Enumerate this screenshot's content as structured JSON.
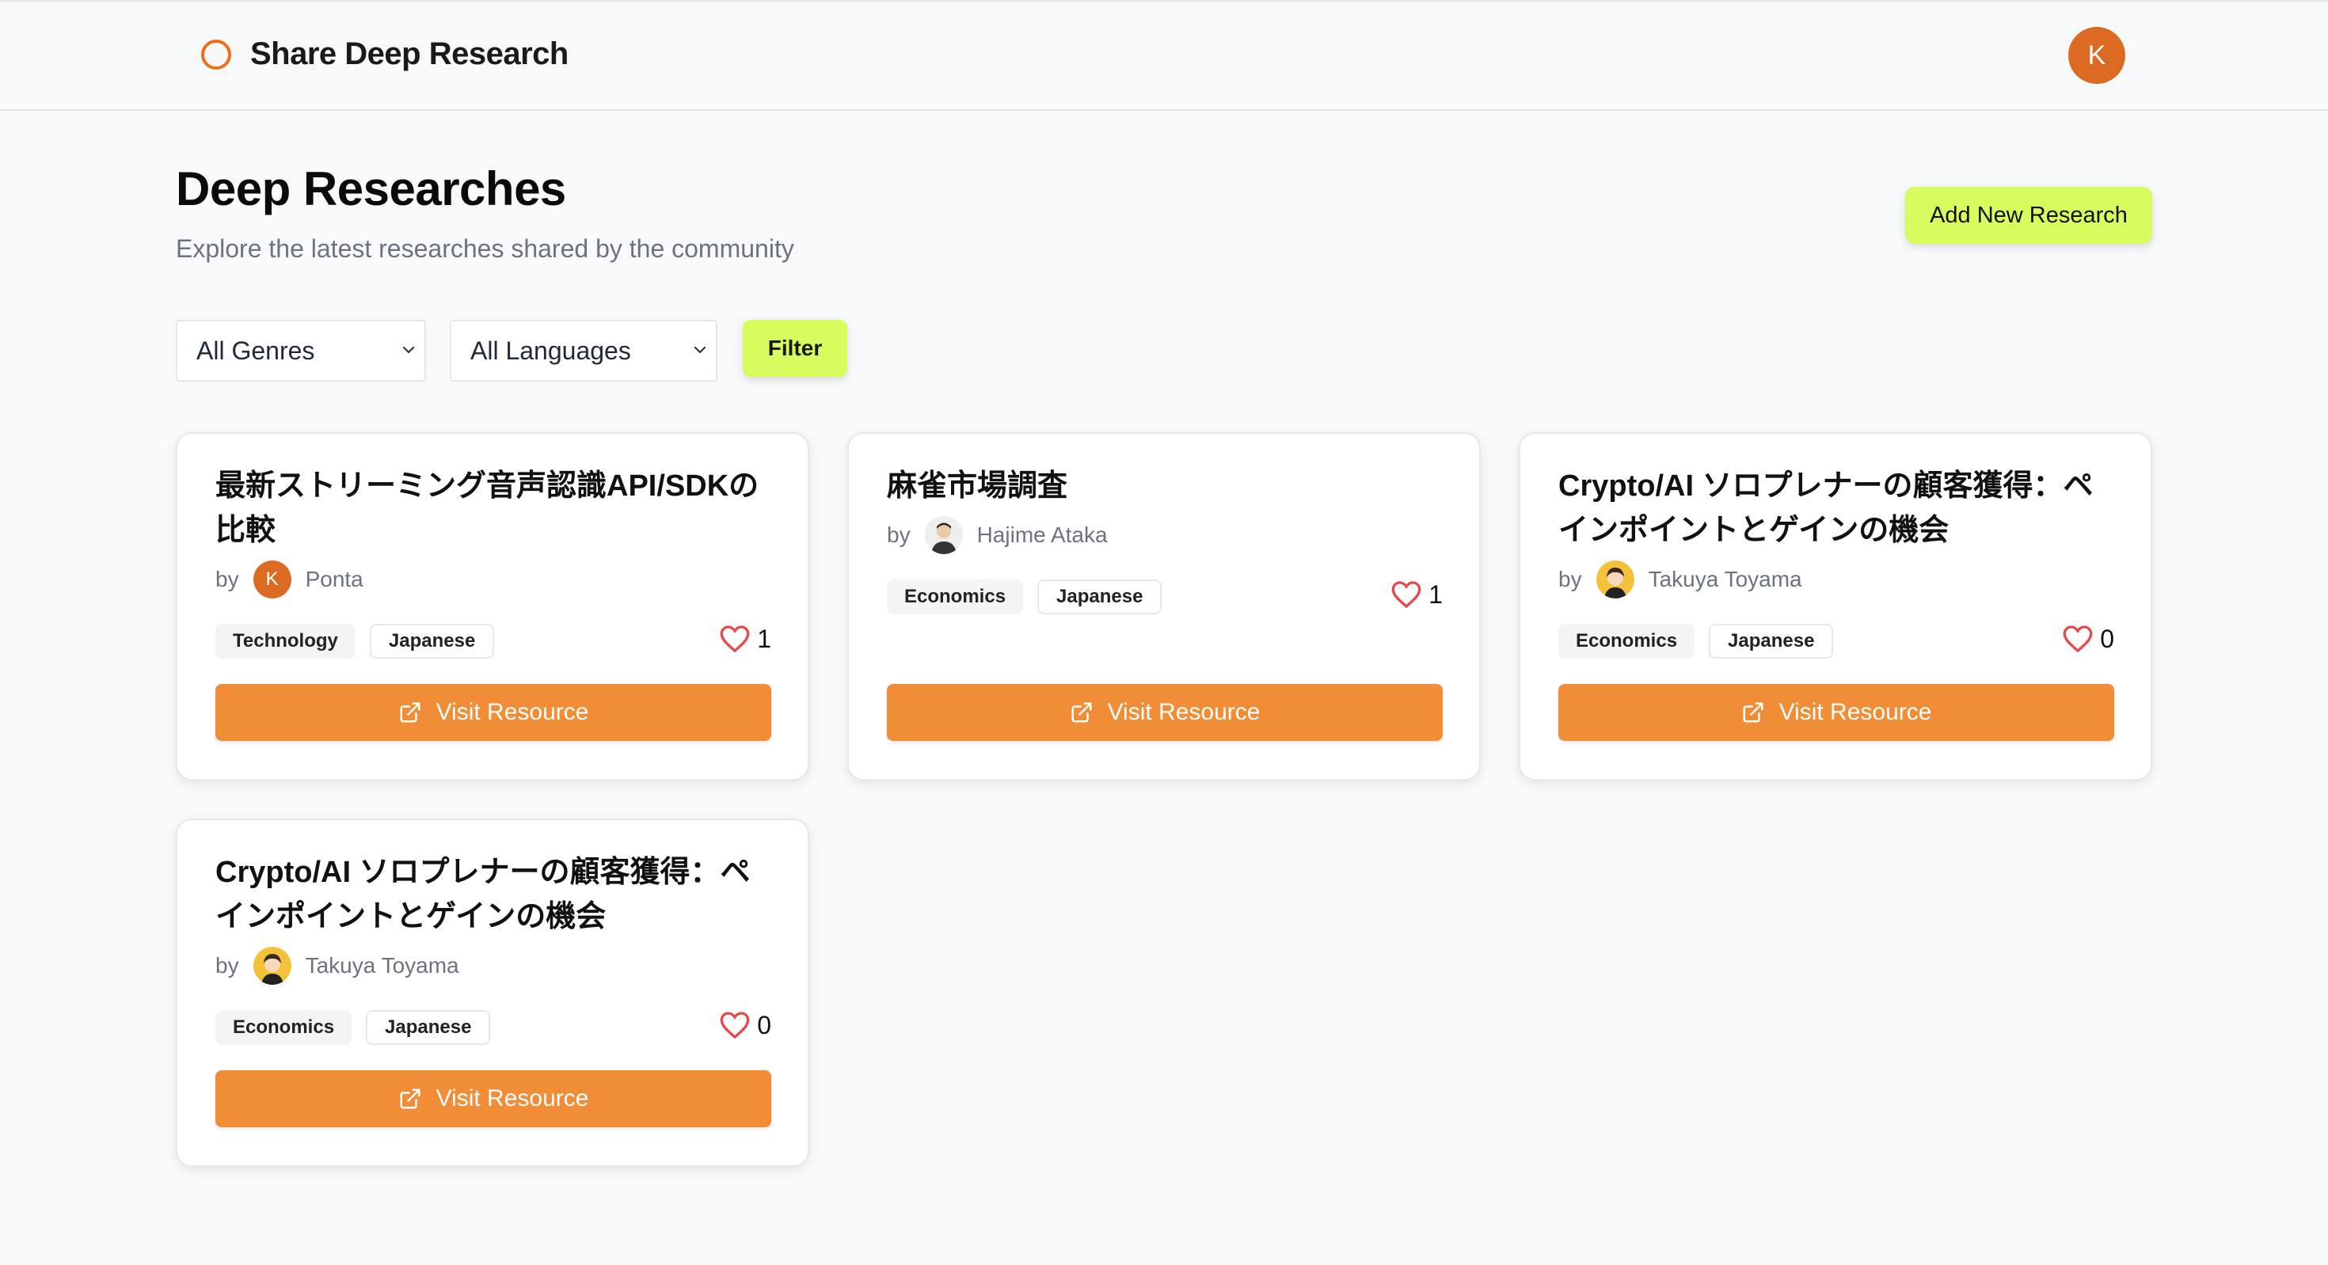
{
  "header": {
    "brand": "Share Deep Research",
    "user_initial": "K"
  },
  "main": {
    "title": "Deep Researches",
    "subtitle": "Explore the latest researches shared by the community",
    "add_button": "Add New Research"
  },
  "filters": {
    "genre_selected": "All Genres",
    "language_selected": "All Languages",
    "filter_button": "Filter"
  },
  "cards": [
    {
      "title": "最新ストリーミング音声認識API/SDKの比較",
      "by": "by",
      "author": "Ponta",
      "author_initial": "K",
      "genre": "Technology",
      "language": "Japanese",
      "likes": "1",
      "visit": "Visit Resource"
    },
    {
      "title": "麻雀市場調査",
      "by": "by",
      "author": "Hajime Ataka",
      "genre": "Economics",
      "language": "Japanese",
      "likes": "1",
      "visit": "Visit Resource"
    },
    {
      "title": "Crypto/AI ソロプレナーの顧客獲得：ペインポイントとゲインの機会",
      "by": "by",
      "author": "Takuya Toyama",
      "genre": "Economics",
      "language": "Japanese",
      "likes": "0",
      "visit": "Visit Resource"
    },
    {
      "title": "Crypto/AI ソロプレナーの顧客獲得：ペインポイントとゲインの機会",
      "by": "by",
      "author": "Takuya Toyama",
      "genre": "Economics",
      "language": "Japanese",
      "likes": "0",
      "visit": "Visit Resource"
    }
  ],
  "colors": {
    "accent": "#d6fc5e",
    "visit": "#f08d36",
    "brand": "#ee6e1e",
    "heart": "#e5484d"
  }
}
